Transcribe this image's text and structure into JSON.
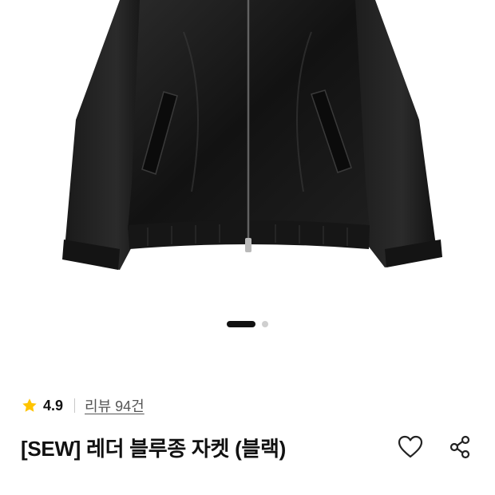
{
  "product": {
    "image_alt": "Black leather blouson jacket",
    "carousel": {
      "total": 2,
      "active": 1
    },
    "rating": "4.9",
    "review_link": "리뷰 94건",
    "title": "[SEW] 레더 블루종 자켓 (블랙)"
  },
  "icons": {
    "rating": "star-icon",
    "wishlist": "heart-icon",
    "share": "share-icon"
  },
  "colors": {
    "star": "#FFC400",
    "text": "#111111",
    "muted": "#555555",
    "dot_active": "#111111",
    "dot_inactive": "#cfcfcf"
  }
}
